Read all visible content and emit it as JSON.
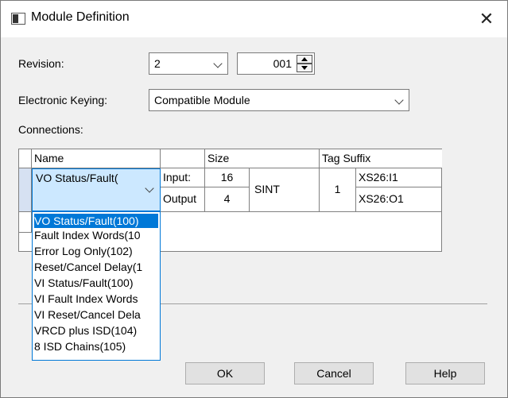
{
  "window": {
    "title": "Module Definition",
    "close_glyph": "✕"
  },
  "revision": {
    "label": "Revision:",
    "major": "2",
    "minor": "001"
  },
  "keying": {
    "label": "Electronic Keying:",
    "value": "Compatible Module"
  },
  "connections": {
    "label": "Connections:",
    "headers": {
      "name": "Name",
      "size": "Size",
      "tag_suffix": "Tag Suffix"
    },
    "selected_name": "VO Status/Fault(",
    "rows": [
      {
        "type": "Input:",
        "size": "16",
        "tag": "XS26:I1"
      },
      {
        "type": "Output",
        "size": "4",
        "tag": "XS26:O1"
      }
    ],
    "data_type": "SINT",
    "count": "1",
    "options": [
      "VO Status/Fault(100)",
      "Fault Index Words(10",
      "Error Log Only(102)",
      "Reset/Cancel Delay(1",
      "VI Status/Fault(100)",
      "VI Fault Index Words",
      "VI Reset/Cancel Dela",
      "VRCD plus ISD(104)",
      "8 ISD Chains(105)"
    ]
  },
  "buttons": {
    "ok": "OK",
    "cancel": "Cancel",
    "help": "Help"
  }
}
